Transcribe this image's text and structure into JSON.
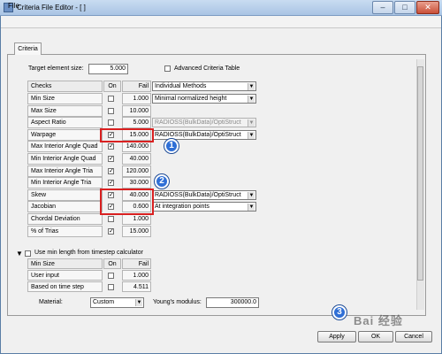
{
  "window": {
    "title": "Criteria File Editor - [ ]",
    "controls": [
      "–",
      "□",
      "✕"
    ]
  },
  "menu": {
    "file": "File"
  },
  "tab": {
    "label": "Criteria"
  },
  "target": {
    "label": "Target element size:",
    "value": "5.000"
  },
  "advanced": {
    "label": "Advanced Criteria Table"
  },
  "table": {
    "headers": {
      "checks": "Checks",
      "on": "On",
      "fail": "Fail"
    },
    "header_select": "Individual Methods",
    "rows": [
      {
        "label": "Min Size",
        "checked": false,
        "fail": "1.000",
        "select": "Minimal normalized height",
        "enabled": true
      },
      {
        "label": "Max Size",
        "checked": false,
        "fail": "10.000"
      },
      {
        "label": "Aspect Ratio",
        "checked": false,
        "fail": "5.000",
        "select": "RADIOSS(BulkData)/OptiStruct",
        "enabled": false
      },
      {
        "label": "Warpage",
        "checked": true,
        "fail": "15.000",
        "select": "RADIOSS(BulkData)/OptiStruct",
        "enabled": true
      },
      {
        "label": "Max Interior Angle Quad",
        "checked": true,
        "fail": "140.000"
      },
      {
        "label": "Min Interior Angle Quad",
        "checked": true,
        "fail": "40.000"
      },
      {
        "label": "Max Interior Angle Tria",
        "checked": true,
        "fail": "120.000"
      },
      {
        "label": "Min Interior Angle Tria",
        "checked": true,
        "fail": "30.000"
      },
      {
        "label": "Skew",
        "checked": true,
        "fail": "40.000",
        "select": "RADIOSS(BulkData)/OptiStruct",
        "enabled": true
      },
      {
        "label": "Jacobian",
        "checked": true,
        "fail": "0.600",
        "select": "At integration points",
        "enabled": true
      },
      {
        "label": "Chordal Deviation",
        "checked": false,
        "fail": "1.000"
      },
      {
        "label": "% of Trias",
        "checked": true,
        "fail": "15.000"
      }
    ]
  },
  "min_length": {
    "label": "Use min length from timestep calculator",
    "headers": {
      "name": "Min Size",
      "on": "On",
      "fail": "Fail"
    },
    "rows": [
      {
        "label": "User input",
        "checked": false,
        "fail": "1.000"
      },
      {
        "label": "Based on time step",
        "checked": false,
        "fail": "4.511"
      }
    ]
  },
  "material": {
    "label": "Material:",
    "value": "Custom"
  },
  "youngs": {
    "label": "Young's modulus:",
    "value": "300000.0"
  },
  "buttons": {
    "apply": "Apply",
    "ok": "OK",
    "cancel": "Cancel"
  },
  "markers": [
    "1",
    "2",
    "3"
  ],
  "watermark": "Bai 经验",
  "colors": {
    "highlight": "#d92020",
    "marker": "#2f6fd6"
  }
}
